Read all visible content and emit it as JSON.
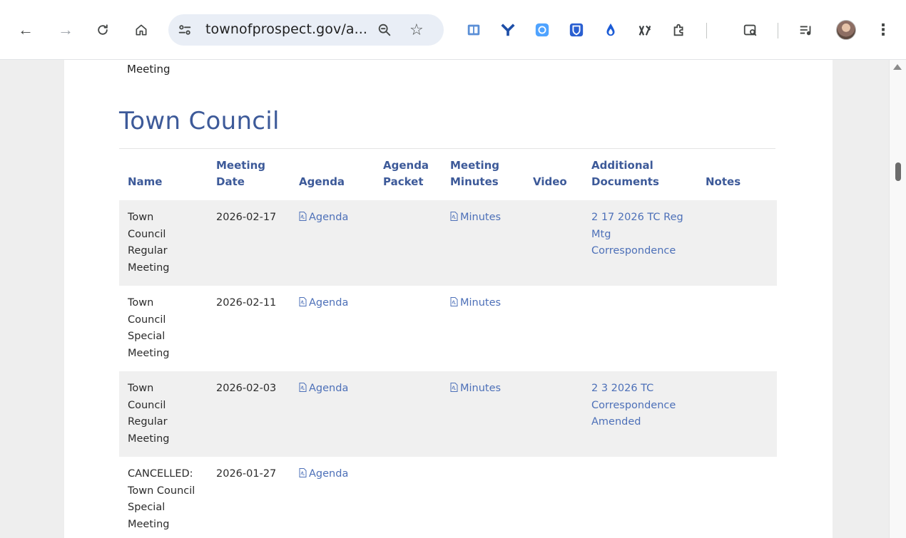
{
  "browser": {
    "url": "townofprospect.gov/a...",
    "back_glyph": "←",
    "forward_glyph": "→",
    "reload_glyph": "C",
    "star_glyph": "☆",
    "menu_glyph": "⋮",
    "extensions": [
      "reader-icon",
      "y-extension-icon",
      "grammarly-icon",
      "bitwarden-icon",
      "raindrop-icon",
      "no-track-icon",
      "extensions-puzzle-icon",
      "tab-search-icon",
      "media-controls-icon"
    ],
    "colors": {
      "toolbar": "#ffffff",
      "omnibox": "#e9eef6"
    }
  },
  "page": {
    "previous_row_tail": "Meeting",
    "section_title": "Town Council",
    "accent": "#3d5a99",
    "link_color": "#4d70b8",
    "columns": [
      "Name",
      "Meeting Date",
      "Agenda",
      "Agenda Packet",
      "Meeting Minutes",
      "Video",
      "Additional Documents",
      "Notes"
    ],
    "rows": [
      {
        "name": "Town Council Regular Meeting",
        "date": "2026-02-17",
        "agenda": "Agenda",
        "packet": "",
        "minutes": "Minutes",
        "video": "",
        "documents": "2 17 2026 TC Reg Mtg Correspondence",
        "notes": ""
      },
      {
        "name": "Town Council Special Meeting",
        "date": "2026-02-11",
        "agenda": "Agenda",
        "packet": "",
        "minutes": "Minutes",
        "video": "",
        "documents": "",
        "notes": ""
      },
      {
        "name": "Town Council Regular Meeting",
        "date": "2026-02-03",
        "agenda": "Agenda",
        "packet": "",
        "minutes": "Minutes",
        "video": "",
        "documents": "2 3 2026 TC Correspondence Amended",
        "notes": ""
      },
      {
        "name": "CANCELLED: Town Council Special Meeting",
        "date": "2026-01-27",
        "agenda": "Agenda",
        "packet": "",
        "minutes": "",
        "video": "",
        "documents": "",
        "notes": ""
      }
    ]
  }
}
